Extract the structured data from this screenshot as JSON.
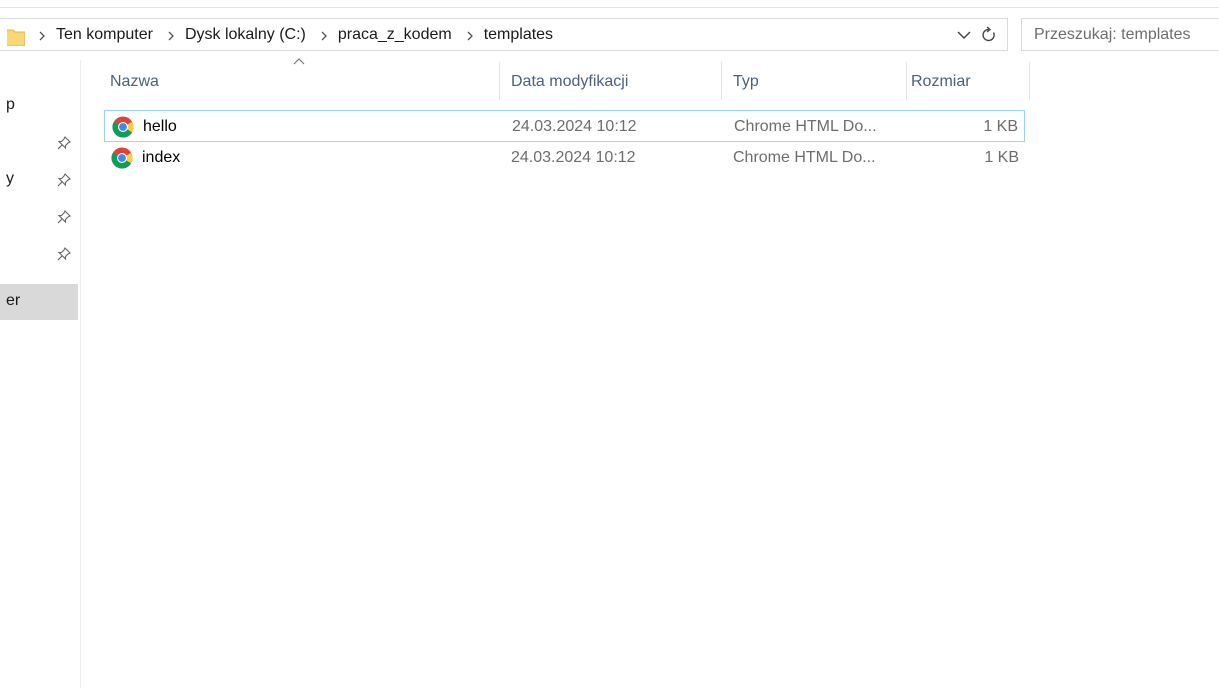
{
  "address": {
    "crumbs": [
      "Ten komputer",
      "Dysk lokalny (C:)",
      "praca_z_kodem",
      "templates"
    ]
  },
  "search": {
    "placeholder": "Przeszukaj: templates"
  },
  "nav": {
    "items": [
      {
        "label": "p",
        "pinned": false
      },
      {
        "label": "",
        "pinned": true
      },
      {
        "label": "y",
        "pinned": true
      },
      {
        "label": "",
        "pinned": true
      },
      {
        "label": "",
        "pinned": true
      },
      {
        "label": "er",
        "pinned": false,
        "selected": true
      }
    ]
  },
  "columns": {
    "name": "Nazwa",
    "date": "Data modyfikacji",
    "type": "Typ",
    "size": "Rozmiar"
  },
  "files": [
    {
      "name": "hello",
      "date": "24.03.2024 10:12",
      "type": "Chrome HTML Do...",
      "size": "1 KB",
      "icon": "chrome-icon",
      "selected": true
    },
    {
      "name": "index",
      "date": "24.03.2024 10:12",
      "type": "Chrome HTML Do...",
      "size": "1 KB",
      "icon": "chrome-icon",
      "selected": false
    }
  ],
  "colors": {
    "selection_border": "#99d1ff",
    "header_text": "#4c607a",
    "nav_selected": "#d9d9d9",
    "folder_yellow": "#f8d775"
  }
}
